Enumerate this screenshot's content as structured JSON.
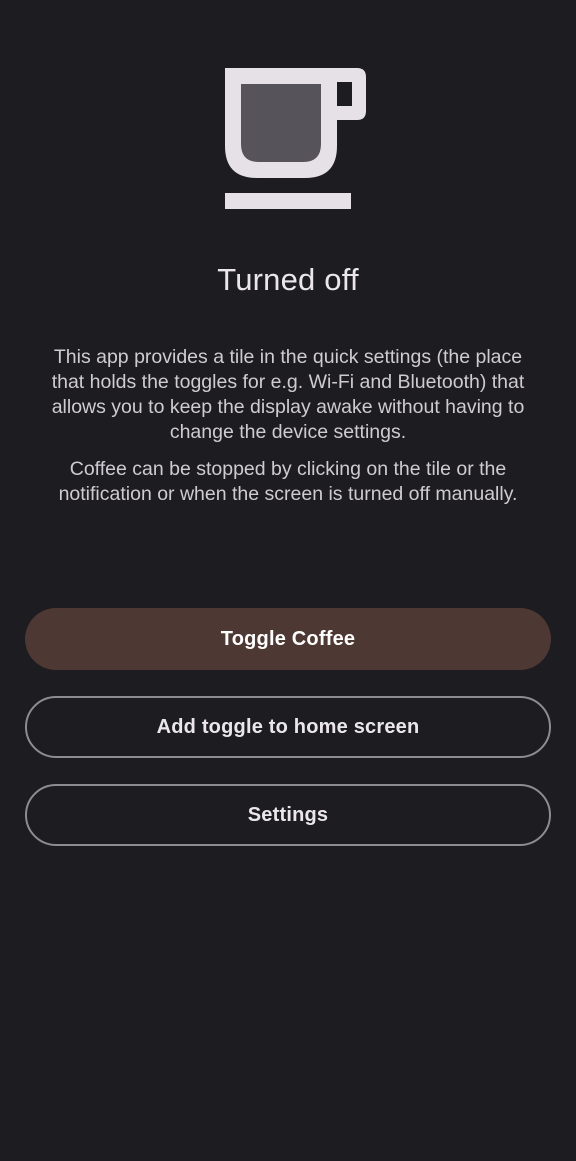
{
  "status": {
    "title": "Turned off"
  },
  "description": {
    "paragraph_1": "This app provides a tile in the quick settings (the place that holds the toggles for e.g. Wi-Fi and Bluetooth) that allows you to keep the display awake without having to change the device settings.",
    "paragraph_2": "Coffee can be stopped by clicking on the tile or the notification or when the screen is turned off manually."
  },
  "actions": {
    "toggle_label": "Toggle Coffee",
    "add_home_label": "Add toggle to home screen",
    "settings_label": "Settings"
  },
  "icons": {
    "hero": "coffee-cup-icon"
  },
  "colors": {
    "background": "#1d1c21",
    "icon_outline": "#e6e1e6",
    "icon_fill": "#56535b",
    "primary_button": "#4e3833",
    "outline_border": "#8f8b93"
  }
}
